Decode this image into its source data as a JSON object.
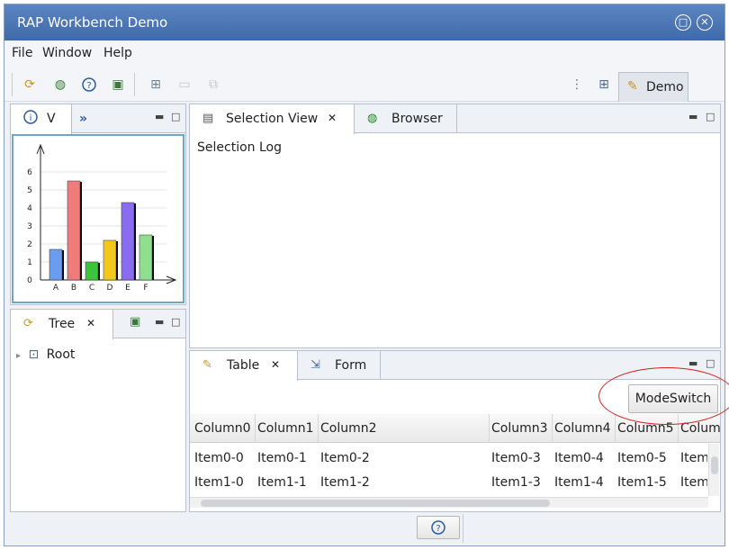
{
  "window": {
    "title": "RAP Workbench Demo"
  },
  "menu": [
    "File",
    "Window",
    "Help"
  ],
  "toolbar": {
    "perspective_label": "Demo",
    "icons": [
      "refresh-icon",
      "globe-icon",
      "help-icon",
      "export-icon",
      "new-window-icon",
      "save-icon",
      "save-all-icon"
    ]
  },
  "left_top_view": {
    "tabs": [
      "V",
      "»"
    ],
    "chart_data": {
      "type": "bar",
      "categories": [
        "A",
        "B",
        "C",
        "D",
        "E",
        "F"
      ],
      "values": [
        1.7,
        5.5,
        1.0,
        2.2,
        4.3,
        2.5
      ],
      "colors": [
        "#6a9df0",
        "#ef7b7b",
        "#3cc43c",
        "#f2c81c",
        "#8a6cf0",
        "#8ee08e"
      ],
      "yticks": [
        "0",
        "1",
        "2",
        "3",
        "4",
        "5",
        "6"
      ],
      "ylim": [
        0,
        6.5
      ],
      "grid": true
    }
  },
  "left_bottom_view": {
    "tab_label": "Tree",
    "root_label": "Root"
  },
  "selection_view": {
    "tabs": [
      "Selection View",
      "Browser"
    ],
    "log_title": "Selection Log"
  },
  "table_view": {
    "tabs": [
      "Table",
      "Form"
    ],
    "mode_switch_label": "ModeSwitch",
    "columns": [
      "Column0",
      "Column1",
      "Column2",
      "Column3",
      "Column4",
      "Column5",
      "Colum"
    ],
    "rows": [
      [
        "Item0-0",
        "Item0-1",
        "Item0-2",
        "Item0-3",
        "Item0-4",
        "Item0-5",
        "Item"
      ],
      [
        "Item1-0",
        "Item1-1",
        "Item1-2",
        "Item1-3",
        "Item1-4",
        "Item1-5",
        "Item"
      ]
    ]
  },
  "status_bar": {
    "help_button": "?"
  },
  "colors": {
    "title_bar": "#4a78b8",
    "annotation": "#d42020"
  }
}
